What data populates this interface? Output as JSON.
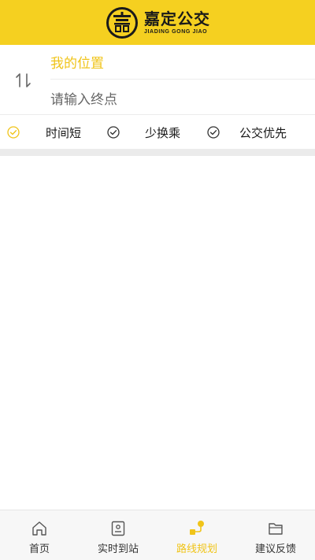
{
  "header": {
    "logo_cn": "嘉定公交",
    "logo_en": "JIADING GONG JIAO"
  },
  "route": {
    "origin": "我的位置",
    "destination_placeholder": "请输入终点"
  },
  "options": [
    {
      "label": "时间短",
      "selected": true
    },
    {
      "label": "少换乘",
      "selected": false
    },
    {
      "label": "公交优先",
      "selected": false
    }
  ],
  "bottom_nav": [
    {
      "label": "首页",
      "icon": "home-icon",
      "active": false
    },
    {
      "label": "实时到站",
      "icon": "phone-icon",
      "active": false
    },
    {
      "label": "路线规划",
      "icon": "route-icon",
      "active": true
    },
    {
      "label": "建议反馈",
      "icon": "folder-icon",
      "active": false
    }
  ],
  "colors": {
    "brand_yellow": "#f5d020",
    "accent": "#f0c419"
  }
}
